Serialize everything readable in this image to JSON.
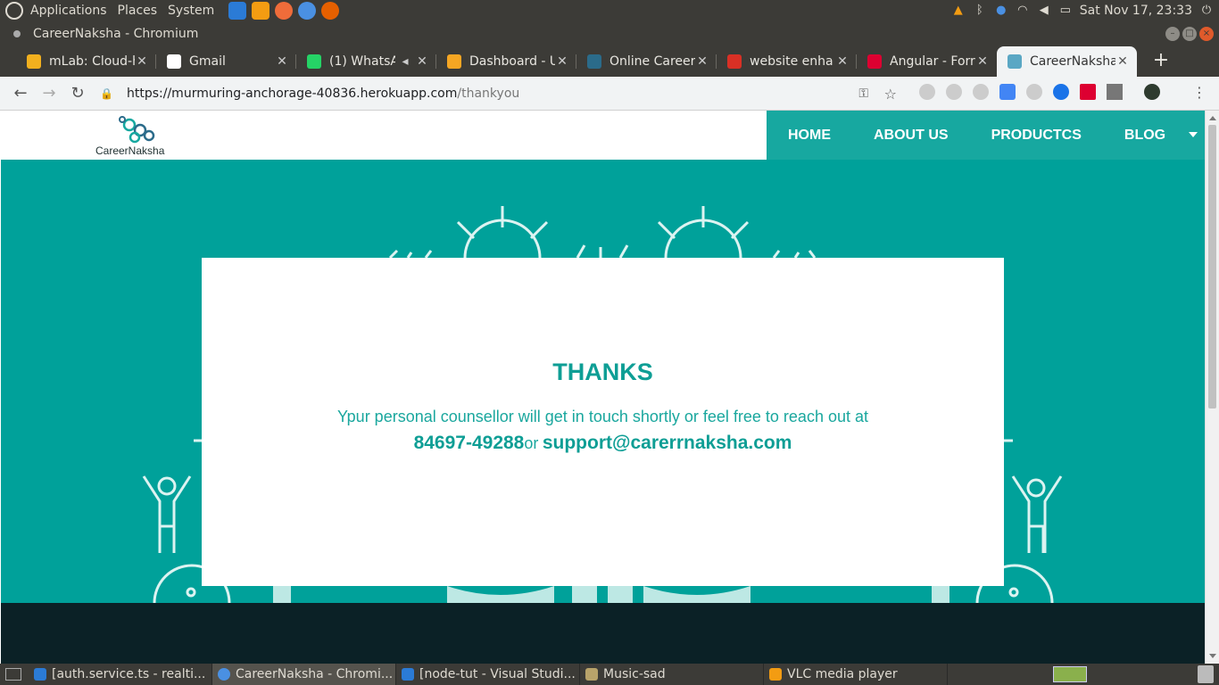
{
  "system_panel": {
    "menus": [
      "Applications",
      "Places",
      "System"
    ],
    "clock": "Sat Nov 17, 23:33"
  },
  "window": {
    "title": "CareerNaksha - Chromium"
  },
  "tabs": [
    {
      "title": "mLab: Cloud-h",
      "favicon": "mlab-icon",
      "color": "#f2b01e"
    },
    {
      "title": "Gmail",
      "favicon": "google-icon",
      "color": "#ffffff"
    },
    {
      "title": "(1) WhatsA",
      "favicon": "whatsapp-icon",
      "color": "#25d366"
    },
    {
      "title": "Dashboard - U",
      "favicon": "dashboard-icon",
      "color": "#f5a623"
    },
    {
      "title": "Online Career",
      "favicon": "career-icon",
      "color": "#2b6b8a"
    },
    {
      "title": "website enha",
      "favicon": "gmail-icon",
      "color": "#d93025"
    },
    {
      "title": "Angular - Forr",
      "favicon": "angular-icon",
      "color": "#dd0031"
    },
    {
      "title": "CareerNaksha",
      "favicon": "careernaksha-icon",
      "color": "#5aa7c4",
      "active": true
    }
  ],
  "address_bar": {
    "url": "https://murmuring-anchorage-40836.herokuapp.com",
    "path": "/thankyou"
  },
  "site": {
    "brand": "CareerNaksha",
    "nav": [
      "HOME",
      "ABOUT US",
      "PRODUCTCS",
      "BLOG"
    ],
    "accent": "#17a8a0",
    "hero_bg": "#00a19a",
    "footer_bg": "#0b2126"
  },
  "thankyou": {
    "heading": "THANKS",
    "message": "Ypur personal counsellor will get in touch shortly or feel free to reach out at",
    "phone": "84697-49288",
    "or": "or",
    "email": "support@carerrnaksha.com"
  },
  "taskbar": {
    "items": [
      {
        "label": "[auth.service.ts - realti...",
        "icon": "vscode-icon"
      },
      {
        "label": "CareerNaksha - Chromi...",
        "icon": "chromium-icon",
        "active": true
      },
      {
        "label": "[node-tut - Visual Studi...",
        "icon": "vscode-icon"
      },
      {
        "label": "Music-sad",
        "icon": "folder-icon"
      },
      {
        "label": "VLC media player",
        "icon": "vlc-icon"
      }
    ]
  }
}
